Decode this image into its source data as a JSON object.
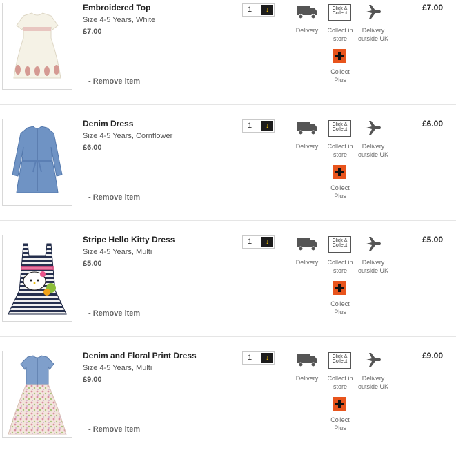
{
  "basket": {
    "items": [
      {
        "title": "Embroidered Top",
        "size": "Size 4-5 Years, White",
        "price": "£7.00",
        "qty": "1",
        "line_price": "£7.00",
        "remove": "- Remove item"
      },
      {
        "title": "Denim Dress",
        "size": "Size 4-5 Years, Cornflower",
        "price": "£6.00",
        "qty": "1",
        "line_price": "£6.00",
        "remove": "- Remove item"
      },
      {
        "title": "Stripe Hello Kitty Dress",
        "size": "Size 4-5 Years, Multi",
        "price": "£5.00",
        "qty": "1",
        "line_price": "£5.00",
        "remove": "- Remove item"
      },
      {
        "title": "Denim and Floral Print Dress",
        "size": "Size 4-5 Years, Multi",
        "price": "£9.00",
        "qty": "1",
        "line_price": "£9.00",
        "remove": "- Remove item"
      }
    ],
    "options": {
      "delivery": "Delivery",
      "click_collect_line1": "Collect in",
      "click_collect_line2": "store",
      "click_collect_badge1": "Click &",
      "click_collect_badge2": "Collect",
      "outside_line1": "Delivery",
      "outside_line2": "outside UK",
      "collectplus_line1": "Collect",
      "collectplus_line2": "Plus"
    },
    "colors": {
      "qty_button_bg": "#1c1c1c",
      "qty_arrow": "#f2c100",
      "collectplus_orange": "#e8541c"
    }
  }
}
